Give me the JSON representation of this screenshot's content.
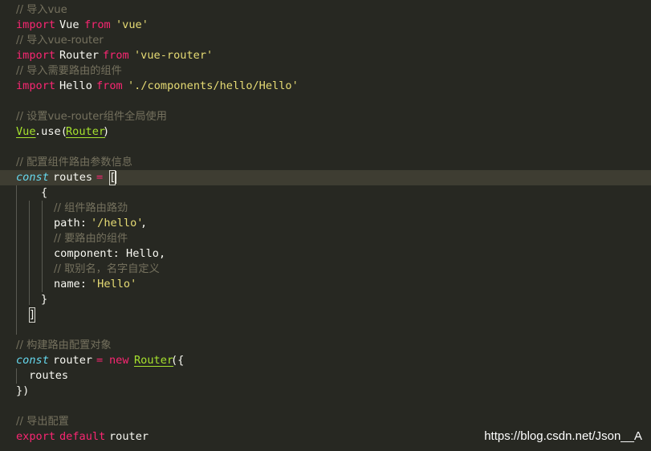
{
  "colors": {
    "background": "#272822",
    "current_line": "#3e3d32",
    "comment": "#75715e",
    "keyword": "#f92672",
    "string": "#e6db74",
    "class_name": "#a6e22e",
    "storage_type": "#66d9ef",
    "text": "#f8f8f2"
  },
  "code": {
    "l1_comment": "// 导入vue",
    "l2_import": "import",
    "l2_name": "Vue",
    "l2_from": "from",
    "l2_str": "'vue'",
    "l3_comment": "// 导入vue-router",
    "l4_import": "import",
    "l4_name": "Router",
    "l4_from": "from",
    "l4_str": "'vue-router'",
    "l5_comment": "// 导入需要路由的组件",
    "l6_import": "import",
    "l6_name": "Hello",
    "l6_from": "from",
    "l6_str": "'./components/hello/Hello'",
    "l8_comment": "// 设置vue-router组件全局使用",
    "l9_vue": "Vue",
    "l9_dot_use": ".use(",
    "l9_router": "Router",
    "l9_close": ")",
    "l11_comment": "// 配置组件路由参数信息",
    "l12_const": "const",
    "l12_name": "routes",
    "l12_eq": "=",
    "l12_bracket": "[",
    "l13_brace": "{",
    "l14_comment": "// 组件路由路劲",
    "l15_key": "path: ",
    "l15_str": "'/hello'",
    "l15_comma": ",",
    "l16_comment": "// 要路由的组件",
    "l17_text": "component: Hello,",
    "l18_comment": "// 取别名，名字自定义",
    "l19_key": "name: ",
    "l19_str": "'Hello'",
    "l20_brace": "}",
    "l21_bracket": "]",
    "l23_comment": "// 构建路由配置对象",
    "l24_const": "const",
    "l24_name": "router",
    "l24_eq": "=",
    "l24_new": "new",
    "l24_router": "Router",
    "l24_open": "({",
    "l25_text": "routes",
    "l26_text": "})",
    "l28_comment": "// 导出配置",
    "l29_export": "export",
    "l29_default": "default",
    "l29_name": "router"
  },
  "watermark": "https://blog.csdn.net/Json__A"
}
